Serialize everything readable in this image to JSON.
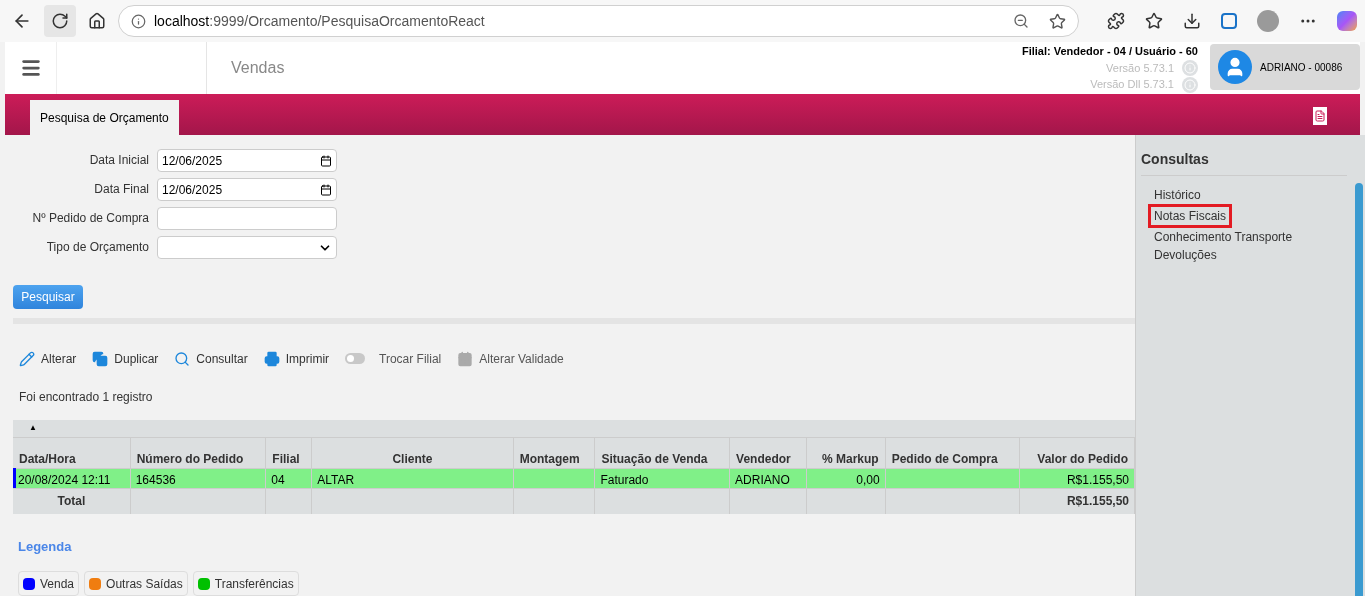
{
  "browser": {
    "url_host": "localhost",
    "url_path": ":9999/Orcamento/PesquisaOrcamentoReact"
  },
  "header": {
    "module": "Vendas",
    "branch_info": "Filial: Vendedor - 04 / Usuário - 60",
    "versions": [
      "Versão 5.73.1",
      "Versão Dll 5.73.1"
    ],
    "user": "ADRIANO - 00086"
  },
  "tabs": [
    {
      "label": "Pesquisa de Orçamento",
      "selected": true
    }
  ],
  "form": {
    "fields": [
      {
        "label": "Data Inicial",
        "kind": "date",
        "value": "12/06/2025"
      },
      {
        "label": "Data Final",
        "kind": "date",
        "value": "12/06/2025"
      },
      {
        "label": "Nº Pedido de Compra",
        "kind": "text"
      },
      {
        "label": "Tipo de Orçamento",
        "kind": "select"
      }
    ],
    "search_button": "Pesquisar"
  },
  "actions": [
    {
      "label": "Alterar",
      "disabled": false
    },
    {
      "label": "Duplicar",
      "disabled": false
    },
    {
      "label": "Consultar",
      "disabled": false
    },
    {
      "label": "Imprimir",
      "disabled": false
    },
    {
      "label": "Trocar Filial",
      "disabled": true
    },
    {
      "label": "Alterar Validade",
      "disabled": true
    }
  ],
  "result_count": "Foi encontrado 1 registro",
  "table": {
    "sort_mark": "▲",
    "columns": [
      "Data/Hora",
      "Número do Pedido",
      "Filial",
      "Cliente",
      "Montagem",
      "Situação de Venda",
      "Vendedor",
      "% Markup",
      "Pedido de Compra",
      "Valor do Pedido"
    ],
    "rows": [
      {
        "selected": true,
        "color": "#0000ff",
        "cells": [
          "20/08/2024 12:11",
          "164536",
          "04",
          "ALTAR",
          null,
          "Faturado",
          "ADRIANO",
          "0,00",
          null,
          "R$1.155,50"
        ]
      }
    ],
    "total": {
      "label": "Total",
      "value": "R$1.155,50"
    }
  },
  "legend": {
    "title": "Legenda",
    "items": [
      {
        "label": "Venda",
        "color": "#0000ff"
      },
      {
        "label": "Outras Saídas",
        "color": "#f07d10"
      },
      {
        "label": "Transferências",
        "color": "#00c000"
      }
    ]
  },
  "sidebar": {
    "title": "Consultas",
    "items": [
      {
        "label": "Histórico",
        "highlighted": false
      },
      {
        "label": "Notas Fiscais",
        "highlighted": true
      },
      {
        "label": "Conhecimento Transporte",
        "highlighted": false
      },
      {
        "label": "Devoluções",
        "highlighted": false
      }
    ]
  }
}
